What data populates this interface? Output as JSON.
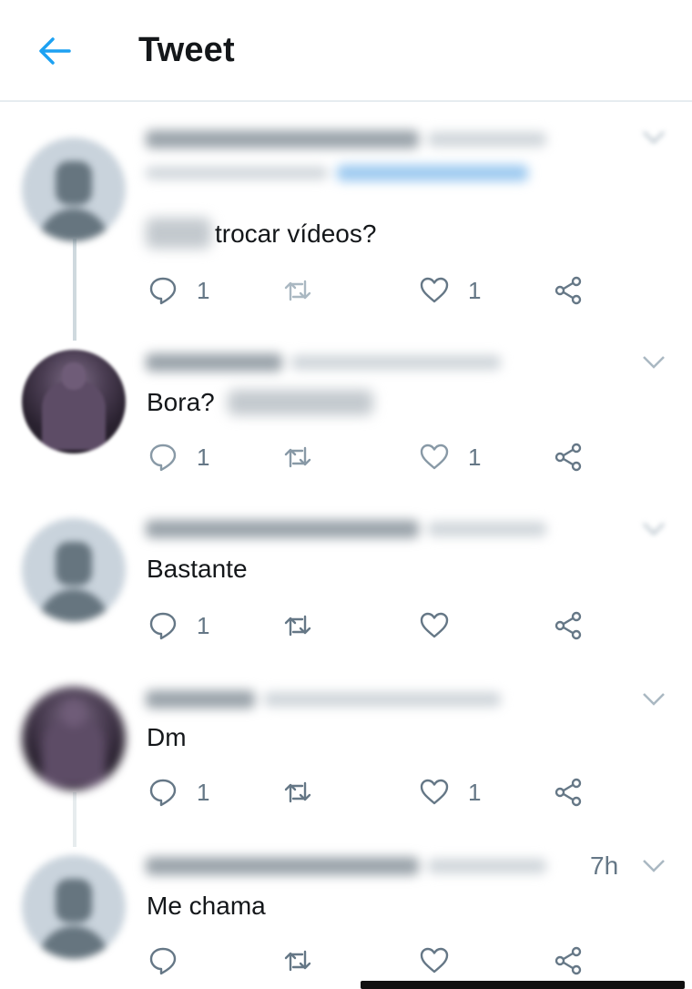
{
  "header": {
    "title": "Tweet"
  },
  "colors": {
    "accent": "#1da1f2",
    "text": "#14171a",
    "muted": "#657786",
    "divider": "#e6ecf0"
  },
  "tweets": [
    {
      "avatar": "default-avatar",
      "time": "",
      "text": "trocar vídeos?",
      "reply_count": "1",
      "retweet_count": "",
      "like_count": "1"
    },
    {
      "avatar": "photo-avatar",
      "time": "",
      "text": "Bora?",
      "reply_count": "1",
      "retweet_count": "",
      "like_count": "1"
    },
    {
      "avatar": "default-avatar",
      "time": "",
      "text": "Bastante",
      "reply_count": "1",
      "retweet_count": "",
      "like_count": ""
    },
    {
      "avatar": "photo-avatar",
      "time": "",
      "text": "Dm",
      "reply_count": "1",
      "retweet_count": "",
      "like_count": "1"
    },
    {
      "avatar": "default-avatar",
      "time": "7h",
      "text": "Me chama",
      "reply_count": "",
      "retweet_count": "",
      "like_count": ""
    }
  ],
  "icons": {
    "back": "arrow-left-icon",
    "reply": "reply-icon",
    "retweet": "retweet-icon",
    "like": "heart-icon",
    "share": "share-icon",
    "more": "chevron-down-icon"
  }
}
